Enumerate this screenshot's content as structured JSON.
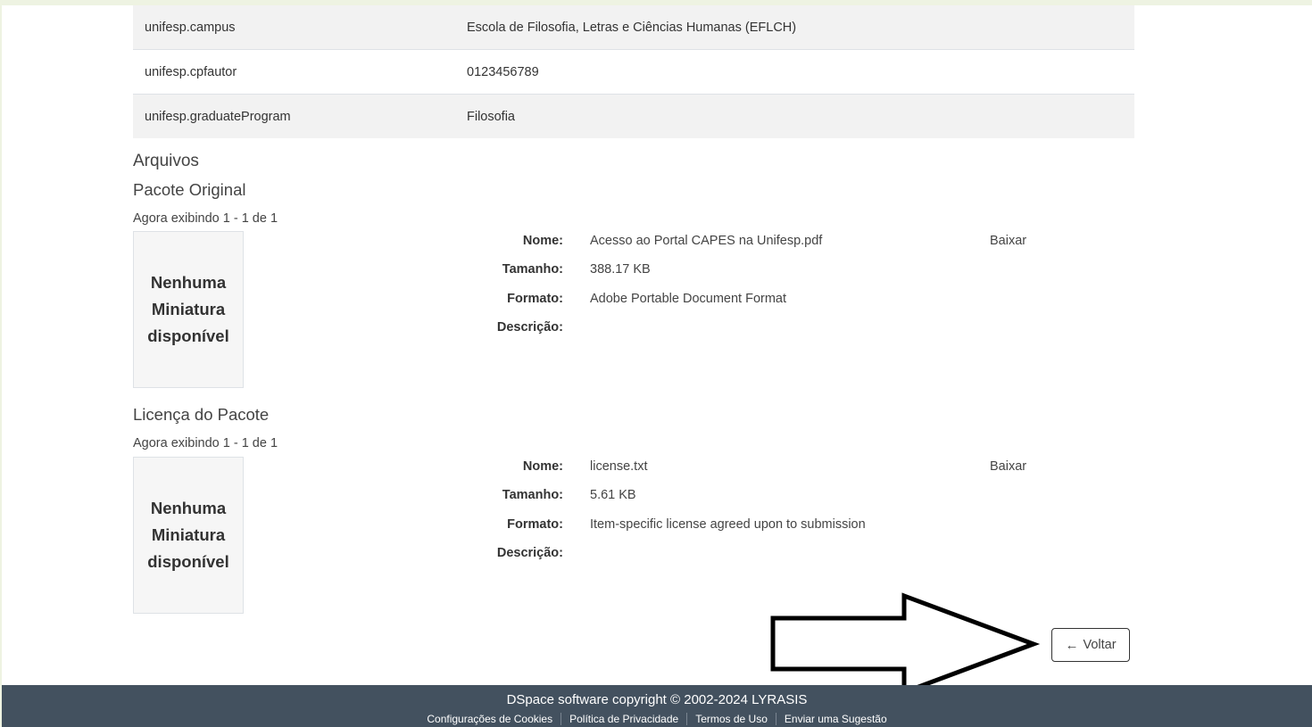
{
  "metadata_rows": [
    {
      "key": "unifesp.campus",
      "value": "Escola de Filosofia, Letras e Ciências Humanas (EFLCH)"
    },
    {
      "key": "unifesp.cpfautor",
      "value": "0123456789"
    },
    {
      "key": "unifesp.graduateProgram",
      "value": "Filosofia"
    }
  ],
  "files": {
    "heading": "Arquivos",
    "labels": {
      "name": "Nome:",
      "size": "Tamanho:",
      "format": "Formato:",
      "description": "Descrição:"
    },
    "download_label": "Baixar",
    "thumbnail_text": "Nenhuma Miniatura disponível",
    "bundles": [
      {
        "title": "Pacote Original",
        "showing": "Agora exibindo 1 - 1 de 1",
        "file": {
          "name": "Acesso ao Portal CAPES na Unifesp.pdf",
          "size": "388.17 KB",
          "format": "Adobe Portable Document Format",
          "description": ""
        }
      },
      {
        "title": "Licença do Pacote",
        "showing": "Agora exibindo 1 - 1 de 1",
        "file": {
          "name": "license.txt",
          "size": "5.61 KB",
          "format": "Item-specific license agreed upon to submission",
          "description": ""
        }
      }
    ]
  },
  "back_button": {
    "label": "Voltar",
    "icon": "arrow-left-icon"
  },
  "annotation": {
    "icon": "outline-arrow-right-icon"
  },
  "footer": {
    "copyright": "DSpace software copyright © 2002-2024 LYRASIS",
    "links": [
      "Configurações de Cookies",
      "Política de Privacidade",
      "Termos de Uso",
      "Enviar uma Sugestão"
    ]
  },
  "colors": {
    "footer_bg": "#43515f",
    "stripe": "#f2f2f2",
    "outer_bg": "#eef3e2"
  }
}
